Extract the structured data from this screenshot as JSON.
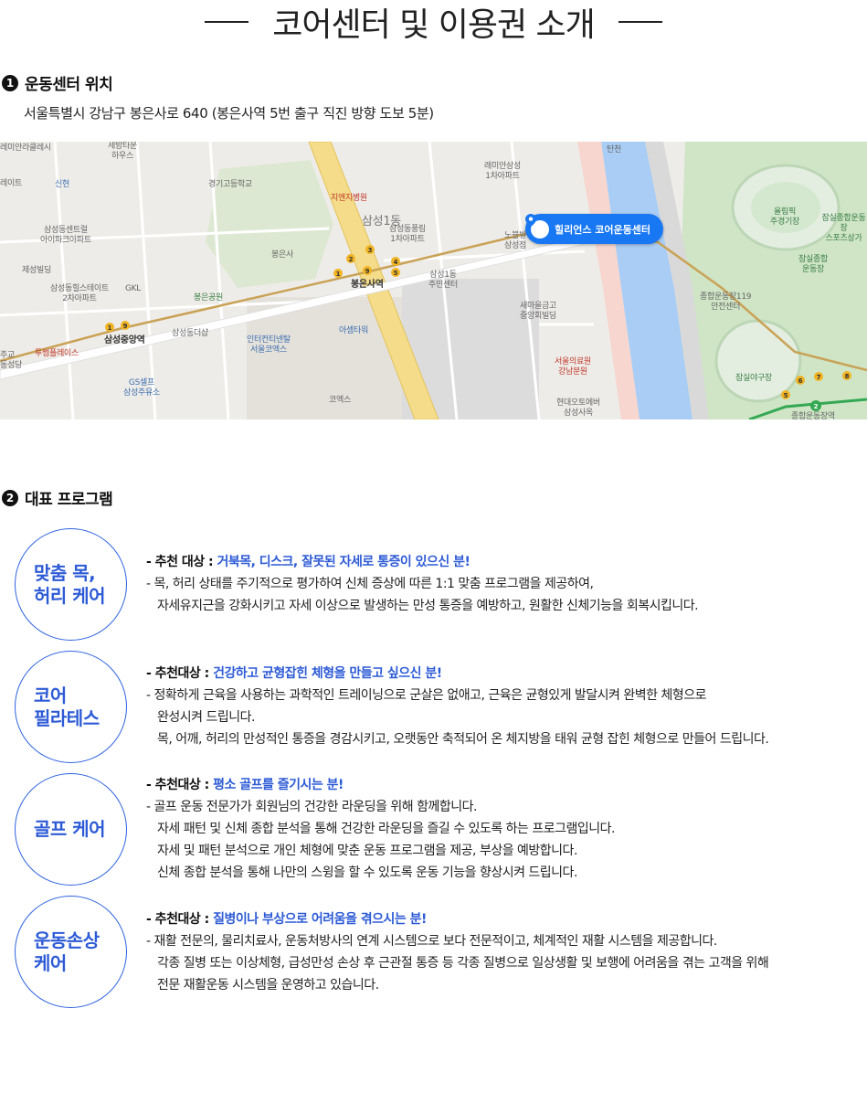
{
  "page_title": "코어센터 및 이용권 소개",
  "section1": {
    "num": "1",
    "title": "운동센터 위치",
    "address": "서울특별시 강남구 봉은사로 640 (봉은사역 5번 출구 직진 방향 도보 5분)"
  },
  "map": {
    "pin_label": "힐리언스 코어운동센터",
    "labels": {
      "l1": "레미안라클레시",
      "l2": "세방타운\n하우스",
      "l3": "신현",
      "l4": "경기고등학교",
      "l5": "지엔지병원",
      "l6": "삼성1동",
      "l7": "삼성동풍림\n1차아파트",
      "l8": "래미안삼성\n1차아파트",
      "l9": "탄천",
      "l10": "올림픽\n주경기장",
      "l11": "잠실종합운동장\n스포츠상가",
      "l12": "잠실종합\n운동장",
      "l13": "삼성동센트럴\n아이파크아파트",
      "l14": "제성빌딩",
      "l15": "봉은사",
      "l16": "삼성동힐스테이트\n2차아파트",
      "l17": "GKL",
      "l18": "봉은공원",
      "l19": "봉은사역",
      "l20": "삼성1동\n주민센터",
      "l21": "새마을금고\n중앙회빌딩",
      "l22": "종합운동장119\n안전센터",
      "l23": "삼성중앙역",
      "l24": "삼성동더샵",
      "l25": "인터컨티넨탈\n서울코엑스",
      "l26": "아셈타워",
      "l27": "투썸플레이스",
      "l28": "잠실야구장",
      "l29": "서울의료원\n강남분원",
      "l30": "GS셀프\n삼성주유소",
      "l31": "코엑스",
      "l32": "현대오토에버\n삼성사옥",
      "l33": "종합운동장역",
      "l34": "노블빌\n삼성점",
      "l35": "레이트",
      "l36": "주교\n동성당"
    }
  },
  "section2": {
    "num": "2",
    "title": "대표 프로그램"
  },
  "programs": [
    {
      "name": "맞춤 목,\n허리 케어",
      "target_label": "- 추천 대상 : ",
      "target_text": "거북목, 디스크, 잘못된 자세로 통증이 있으신 분!",
      "lines": [
        "- 목, 허리 상태를 주기적으로 평가하여 신체 증상에 따른 1:1 맞춤 프로그램을 제공하여,",
        "자세유지근을 강화시키고 자세 이상으로 발생하는 만성 통증을 예방하고, 원활한 신체기능을 회복시킵니다."
      ]
    },
    {
      "name": "코어\n필라테스",
      "target_label": "- 추천대상 : ",
      "target_text": "건강하고 균형잡힌 체형을 만들고 싶으신 분!",
      "lines": [
        "- 정확하게 근육을 사용하는 과학적인 트레이닝으로 군살은 없애고, 근육은 균형있게 발달시켜 완벽한 체형으로",
        "완성시켜 드립니다.",
        "목, 어깨, 허리의 만성적인 통증을 경감시키고, 오랫동안 축적되어 온 체지방을 태워 균형 잡힌 체형으로 만들어 드립니다."
      ]
    },
    {
      "name": "골프 케어",
      "target_label": "- 추천대상 : ",
      "target_text": "평소 골프를 즐기시는 분!",
      "lines": [
        "- 골프 운동 전문가가 회원님의 건강한 라운딩을 위해 함께합니다.",
        "자세 패턴 및 신체 종합 분석을 통해 건강한 라운딩을 즐길 수 있도록 하는 프로그램입니다.",
        "자세 및 패턴 분석으로 개인 체형에 맞춘 운동 프로그램을 제공, 부상을 예방합니다.",
        "신체 종합 분석을 통해 나만의 스윙을 할 수 있도록 운동 기능을 향상시켜 드립니다."
      ]
    },
    {
      "name": "운동손상\n케어",
      "target_label": "- 추천대상 : ",
      "target_text": "질병이나 부상으로 어려움을 겪으시는 분!",
      "lines": [
        "- 재활 전문의, 물리치료사, 운동처방사의 연계 시스템으로 보다 전문적이고, 체계적인 재활 시스템을 제공합니다.",
        "각종 질병 또는 이상체형, 급성만성 손상 후 근관절 통증 등 각종 질병으로 일상생활 및 보행에 어려움을 겪는 고객을 위해",
        "전문 재활운동 시스템을 운영하고 있습니다."
      ]
    }
  ],
  "colors": {
    "accent_blue": "#2d5bd6",
    "pin_blue": "#1877f2",
    "river": "#a9cdf5",
    "park": "#cfe5c6",
    "subway_gold": "#c9a256"
  }
}
